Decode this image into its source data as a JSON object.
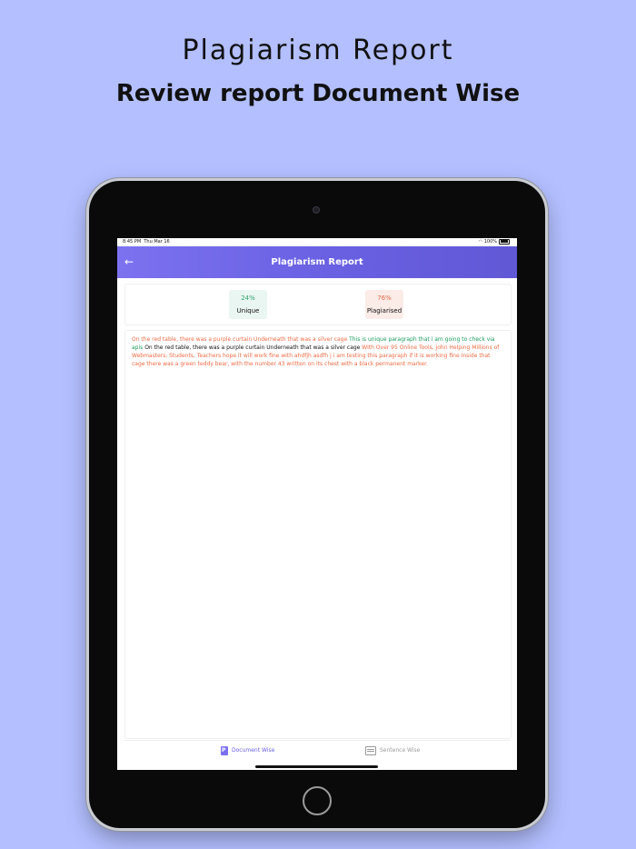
{
  "header": {
    "title": "Plagiarism Report",
    "subtitle": "Review report Document Wise"
  },
  "statusbar": {
    "time": "8:45 PM",
    "date": "Thu Mar 16",
    "battery": "100%"
  },
  "navbar": {
    "back_icon": "arrow-left-icon",
    "back_glyph": "←",
    "title": "Plagiarism Report"
  },
  "stats": {
    "unique_percent": "24%",
    "unique_label": "Unique",
    "plagiarised_percent": "76%",
    "plagiarised_label": "Plagiarised",
    "unique_color": "#2fa46e",
    "plagiarised_color": "#e66a4a"
  },
  "document": {
    "segments": [
      {
        "type": "plagiarised",
        "text": "On the red table, there was a purple curtain Underneath that was a silver cage "
      },
      {
        "type": "unique",
        "text": "This is unique paragraph that i am going to check via apis "
      },
      {
        "type": "plain",
        "text": "On the red table, there was a purple curtain Underneath that was a silver cage "
      },
      {
        "type": "plagiarised",
        "text": "With Over 95 Online Tools, john Helping Millions of Webmasters, Students, Teachers hope it will work fine with ahdfjh asdfh j i am testing this paragraph if it is working fine Inside that cage there was a green teddy bear, with the number 43 written on its chest with a black permanent marker."
      }
    ]
  },
  "tabs": [
    {
      "label": "Document Wise",
      "icon": "document-icon",
      "active": true
    },
    {
      "label": "Sentence Wise",
      "icon": "sentence-list-icon",
      "active": false
    }
  ],
  "colors": {
    "background": "#b3bfff",
    "accent": "#6a61e3",
    "plagiarised_text": "#ee6b44",
    "unique_text": "#1a9c5a"
  }
}
